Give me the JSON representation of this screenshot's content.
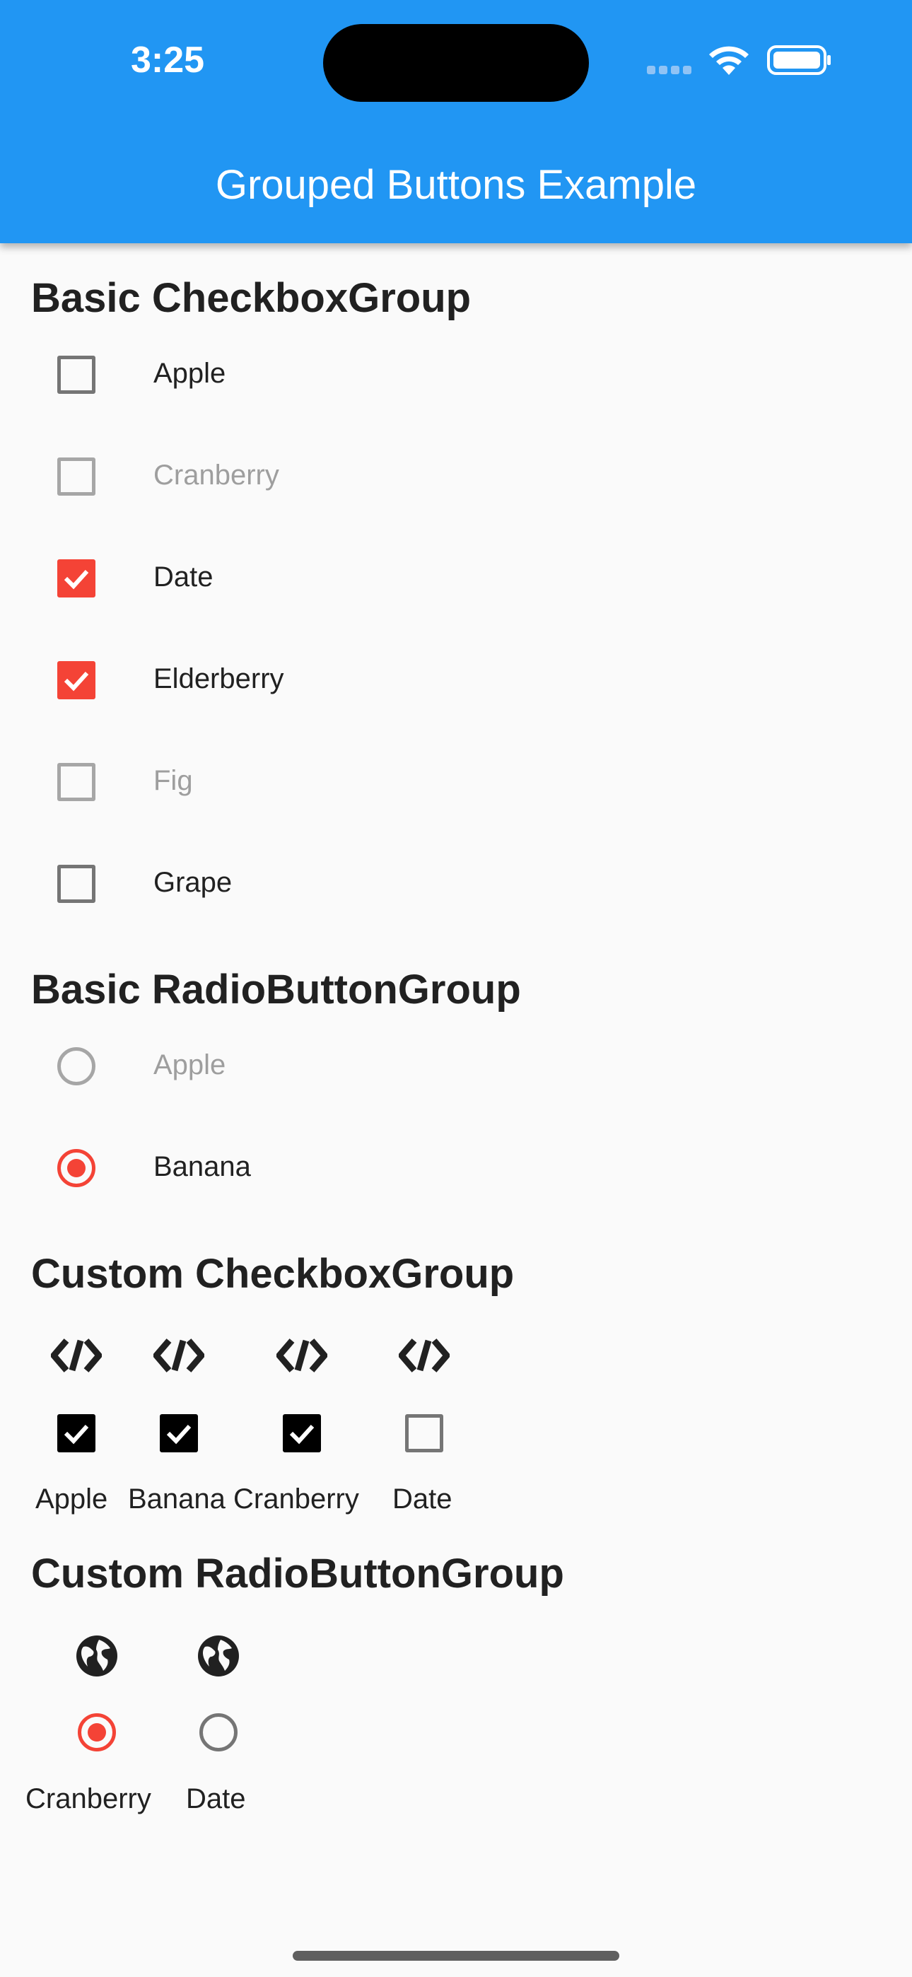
{
  "status_bar": {
    "time": "3:25",
    "icons": [
      "signal-icon",
      "wifi-icon",
      "battery-icon"
    ]
  },
  "app_bar": {
    "title": "Grouped Buttons Example",
    "color": "#2196f3"
  },
  "basic_checkbox_group": {
    "title": "Basic CheckboxGroup",
    "items": [
      {
        "label": "Apple",
        "checked": false,
        "disabled": false
      },
      {
        "label": "Cranberry",
        "checked": false,
        "disabled": true
      },
      {
        "label": "Date",
        "checked": true,
        "disabled": false
      },
      {
        "label": "Elderberry",
        "checked": true,
        "disabled": false
      },
      {
        "label": "Fig",
        "checked": false,
        "disabled": true
      },
      {
        "label": "Grape",
        "checked": false,
        "disabled": false
      }
    ]
  },
  "basic_radio_group": {
    "title": "Basic RadioButtonGroup",
    "items": [
      {
        "label": "Apple",
        "selected": false,
        "disabled": true
      },
      {
        "label": "Banana",
        "selected": true,
        "disabled": false
      }
    ]
  },
  "custom_checkbox_group": {
    "title": "Custom CheckboxGroup",
    "icon": "code-icon",
    "items": [
      {
        "label": "Apple",
        "checked": true
      },
      {
        "label": "Banana",
        "checked": true
      },
      {
        "label": "Cranberry",
        "checked": true
      },
      {
        "label": "Date",
        "checked": false
      }
    ]
  },
  "custom_radio_group": {
    "title": "Custom RadioButtonGroup",
    "icon": "globe-icon",
    "items": [
      {
        "label": "Cranberry",
        "selected": true
      },
      {
        "label": "Date",
        "selected": false
      }
    ]
  },
  "colors": {
    "accent": "#f44336",
    "unchecked": "#757575",
    "disabled": "#9e9e9e"
  }
}
